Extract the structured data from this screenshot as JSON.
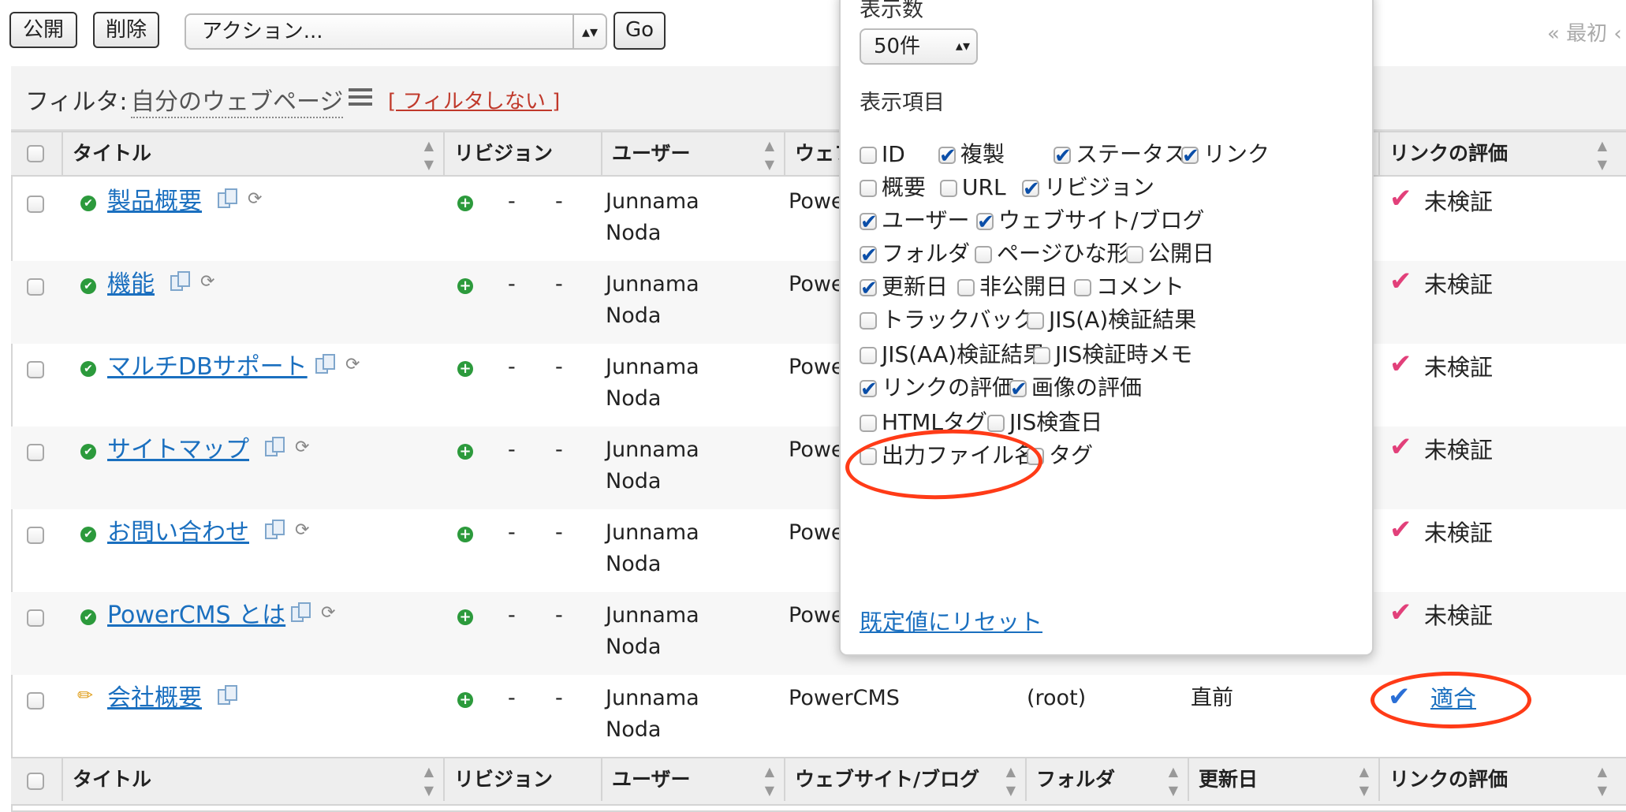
{
  "toolbar": {
    "publish_label": "公開",
    "delete_label": "削除",
    "action_selected": "アクション...",
    "go_label": "Go",
    "pager_first": "« 最初 ‹"
  },
  "filter": {
    "label": "フィルタ:",
    "value": "自分のウェブページ",
    "clear_label": "[ フィルタしない ]"
  },
  "columns": {
    "title": "タイトル",
    "revision": "リビジョン",
    "user": "ユーザー",
    "website": "ウェブサイト/ブログ",
    "website_partial": "ウェフ",
    "folder": "フォルダ",
    "updated": "更新日",
    "link_eval": "リンクの評価"
  },
  "rows": [
    {
      "title": "製品概要",
      "rev_a": "-",
      "rev_b": "-",
      "user1": "Junnama",
      "user2": "Noda",
      "website": "Powe",
      "folder": "",
      "updated": "",
      "link_eval": "未検証"
    },
    {
      "title": "機能",
      "rev_a": "-",
      "rev_b": "-",
      "user1": "Junnama",
      "user2": "Noda",
      "website": "Powe",
      "folder": "",
      "updated": "",
      "link_eval": "未検証"
    },
    {
      "title": "マルチDBサポート",
      "rev_a": "-",
      "rev_b": "-",
      "user1": "Junnama",
      "user2": "Noda",
      "website": "Powe",
      "folder": "",
      "updated": "",
      "link_eval": "未検証"
    },
    {
      "title": "サイトマップ",
      "rev_a": "-",
      "rev_b": "-",
      "user1": "Junnama",
      "user2": "Noda",
      "website": "Powe",
      "folder": "",
      "updated": "",
      "link_eval": "未検証"
    },
    {
      "title": "お問い合わせ",
      "rev_a": "-",
      "rev_b": "-",
      "user1": "Junnama",
      "user2": "Noda",
      "website": "Powe",
      "folder": "",
      "updated": "",
      "link_eval": "未検証"
    },
    {
      "title": "PowerCMS とは",
      "rev_a": "-",
      "rev_b": "-",
      "user1": "Junnama",
      "user2": "Noda",
      "website": "Powe",
      "folder": "",
      "updated": "",
      "link_eval": "未検証"
    },
    {
      "title": "会社概要",
      "rev_a": "-",
      "rev_b": "-",
      "user1": "Junnama",
      "user2": "Noda",
      "website": "PowerCMS",
      "folder": "(root)",
      "updated": "直前",
      "link_eval": "適合"
    }
  ],
  "popup": {
    "count_label": "表示数",
    "count_value": "50件",
    "items_label": "表示項目",
    "options": [
      {
        "label": "ID",
        "checked": false
      },
      {
        "label": "複製",
        "checked": true
      },
      {
        "label": "ステータス",
        "checked": true
      },
      {
        "label": "リンク",
        "checked": true
      },
      {
        "label": "概要",
        "checked": false
      },
      {
        "label": "URL",
        "checked": false
      },
      {
        "label": "リビジョン",
        "checked": true
      },
      {
        "label": "ユーザー",
        "checked": true
      },
      {
        "label": "ウェブサイト/ブログ",
        "checked": true
      },
      {
        "label": "フォルダ",
        "checked": true
      },
      {
        "label": "ページひな形",
        "checked": false
      },
      {
        "label": "公開日",
        "checked": false
      },
      {
        "label": "更新日",
        "checked": true
      },
      {
        "label": "非公開日",
        "checked": false
      },
      {
        "label": "コメント",
        "checked": false
      },
      {
        "label": "トラックバック",
        "checked": false
      },
      {
        "label": "JIS(A)検証結果",
        "checked": false
      },
      {
        "label": "JIS(AA)検証結果",
        "checked": false
      },
      {
        "label": "JIS検証時メモ",
        "checked": false
      },
      {
        "label": "リンクの評価",
        "checked": true
      },
      {
        "label": "画像の評価",
        "checked": true
      },
      {
        "label": "HTMLタグ",
        "checked": false
      },
      {
        "label": "JIS検査日",
        "checked": false
      },
      {
        "label": "出力ファイル名",
        "checked": false
      },
      {
        "label": "タグ",
        "checked": false
      }
    ],
    "reset_label": "既定値にリセット"
  },
  "colors": {
    "accent_link": "#1a6fbf",
    "highlight": "#ff3b17",
    "status_ok": "#2c9a3c"
  }
}
